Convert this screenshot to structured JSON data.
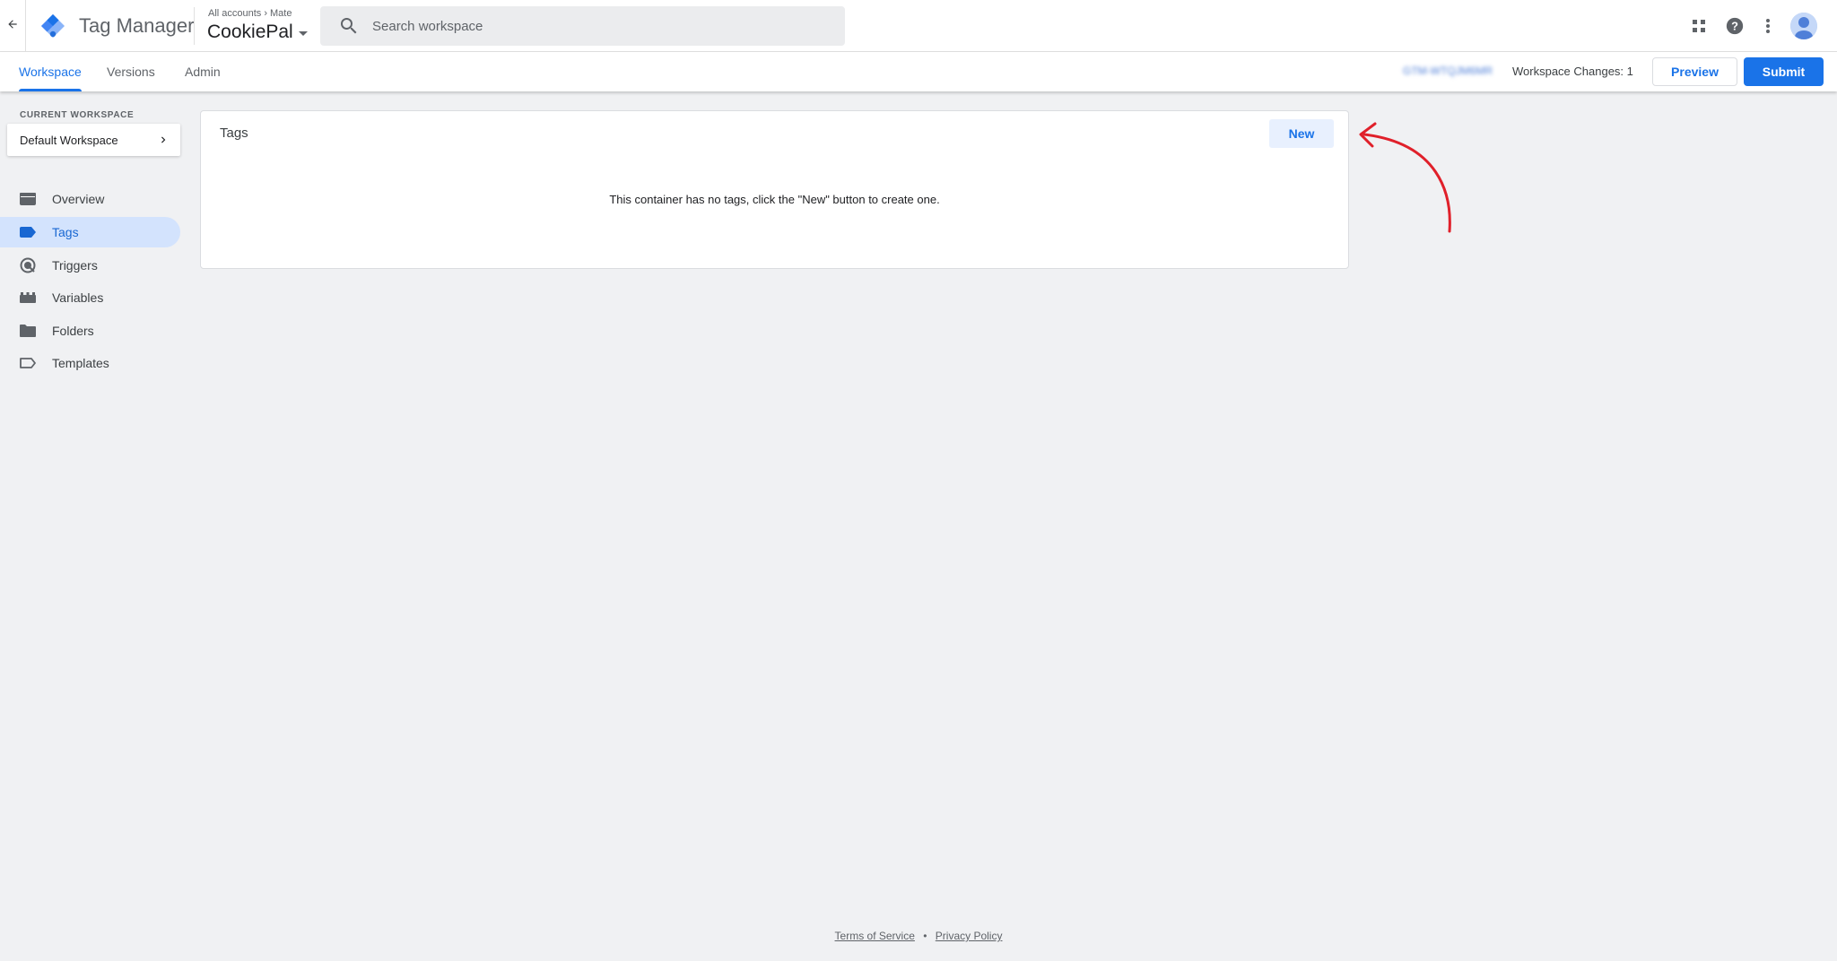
{
  "header": {
    "app_title": "Tag Manager",
    "breadcrumb": {
      "all_accounts": "All accounts",
      "account": "Mate"
    },
    "container_name": "CookiePal",
    "search": {
      "placeholder": "Search workspace",
      "value": ""
    },
    "icons": [
      "back-arrow-icon",
      "gtm-logo-icon",
      "search-icon",
      "apps-grid-icon",
      "help-icon",
      "more-vert-icon",
      "avatar-icon"
    ]
  },
  "tabs": [
    {
      "label": "Workspace",
      "active": true
    },
    {
      "label": "Versions",
      "active": false
    },
    {
      "label": "Admin",
      "active": false
    }
  ],
  "toolbar": {
    "container_id": "GTM-WTQJM6MR",
    "workspace_changes": "Workspace Changes: 1",
    "preview_label": "Preview",
    "submit_label": "Submit"
  },
  "sidebar": {
    "current_workspace_label": "CURRENT WORKSPACE",
    "workspace_name": "Default Workspace",
    "items": [
      {
        "label": "Overview",
        "icon": "overview-icon",
        "active": false
      },
      {
        "label": "Tags",
        "icon": "tag-icon",
        "active": true
      },
      {
        "label": "Triggers",
        "icon": "trigger-icon",
        "active": false
      },
      {
        "label": "Variables",
        "icon": "variables-icon",
        "active": false
      },
      {
        "label": "Folders",
        "icon": "folder-icon",
        "active": false
      },
      {
        "label": "Templates",
        "icon": "template-icon",
        "active": false
      }
    ]
  },
  "main": {
    "card_title": "Tags",
    "new_button_label": "New",
    "empty_message": "This container has no tags, click the \"New\" button to create one."
  },
  "footer": {
    "terms": "Terms of Service",
    "separator": "•",
    "privacy": "Privacy Policy"
  },
  "colors": {
    "accent": "#1a73e8",
    "page_background": "#f0f1f3",
    "active_nav_background": "#d3e3fd",
    "annotation_arrow": "#e0202a"
  }
}
